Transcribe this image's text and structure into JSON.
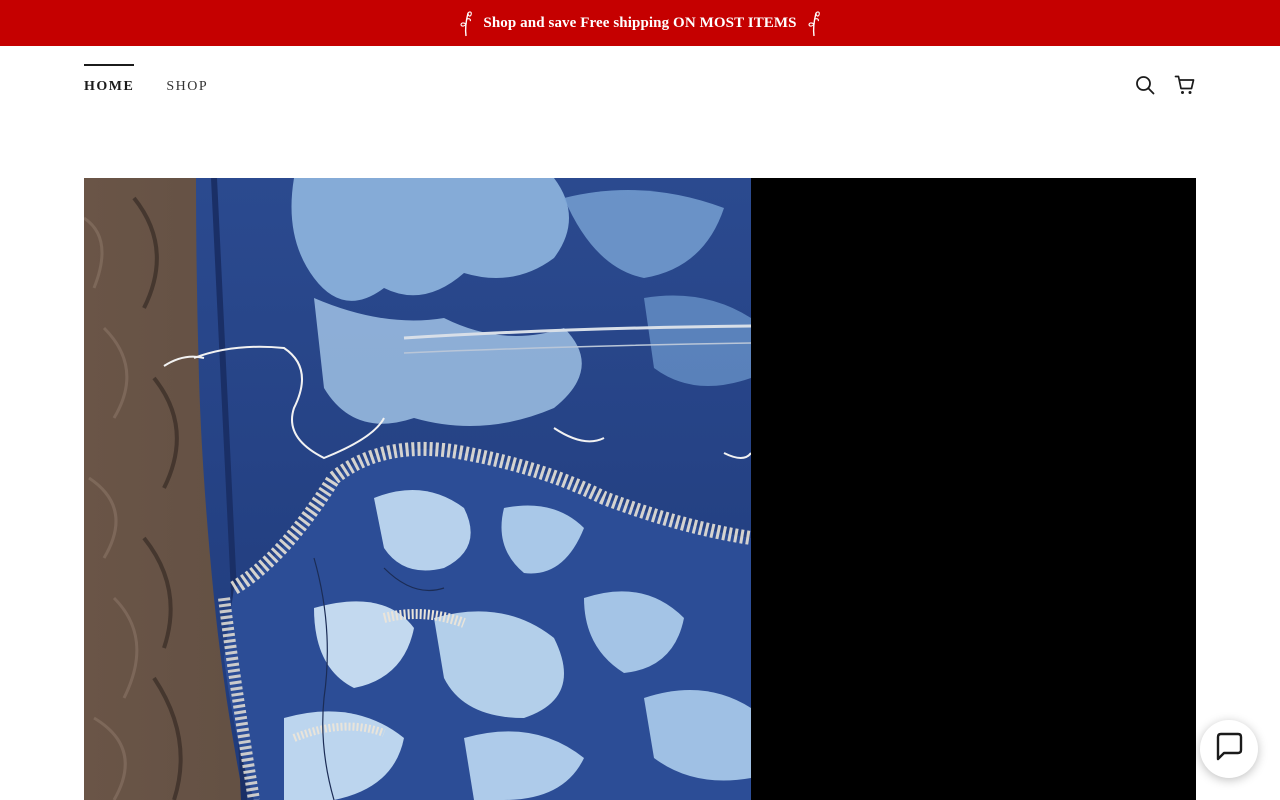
{
  "promo": {
    "text": "Shop and save Free shipping ON MOST ITEMS",
    "background": "#c50000",
    "left_icon": "flower-sprig-icon",
    "right_icon": "flower-sprig-icon"
  },
  "nav": {
    "items": [
      {
        "label": "HOME",
        "active": true
      },
      {
        "label": "SHOP",
        "active": false
      }
    ]
  },
  "header_icons": {
    "search": "search-icon",
    "cart": "cart-icon"
  },
  "hero": {
    "image": "bleached-denim-patchwork-photo",
    "side_panel_color": "#000000"
  },
  "chat": {
    "icon": "chat-bubble-icon"
  }
}
